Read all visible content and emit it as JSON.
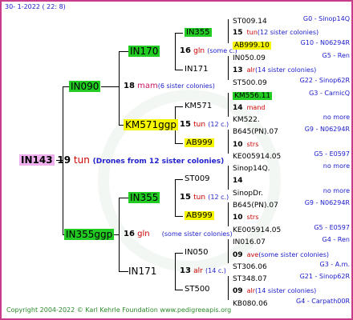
{
  "header": {
    "date": "30-   1-2022  ( 22:   8)"
  },
  "footer": {
    "copyright": "Copyright 2004-2022 © Karl Kehrle Foundation    www.pedigreeapis.org"
  },
  "root": {
    "id": "IN143",
    "gen": "19",
    "breed": "tun",
    "note": "(Drones from 12 sister colonies)"
  },
  "s": {
    "id": "IN090",
    "gen": "18",
    "breed": "mam",
    "note": "(6 sister colonies)"
  },
  "d": {
    "id": "IN355ggp",
    "gen": "16",
    "breed": "gln",
    "note": "(some sister colonies)"
  },
  "ss": {
    "id": "IN170",
    "gen": "16",
    "breed": "gln",
    "note": "(some c.)"
  },
  "sd": {
    "id": "KM571ggp",
    "gen": "15",
    "breed": "tun",
    "note": "(12 c.)"
  },
  "ds": {
    "id": "IN355",
    "gen": "15",
    "breed": "tun",
    "note": "(12 c.)"
  },
  "dd": {
    "id": "IN171",
    "gen": "13",
    "breed": "alr",
    "note": "(14 c.)"
  },
  "g4": [
    {
      "id": "IN355"
    },
    {
      "id": "IN171"
    },
    {
      "id": "KM571"
    },
    {
      "id": "AB999"
    },
    {
      "id": "ST009"
    },
    {
      "id": "AB999"
    },
    {
      "id": "IN050"
    },
    {
      "id": "ST500"
    }
  ],
  "g5": [
    {
      "id": "ST009.14",
      "gen": "",
      "breed": "",
      "note": "",
      "right": "G0 - Sinop14Q"
    },
    {
      "id": "",
      "gen": "15",
      "breed": "tun",
      "note": "(12 sister colonies)",
      "right": ""
    },
    {
      "id": "AB999.10",
      "gen": "",
      "breed": "",
      "note": "",
      "right": "G10 - N06294R"
    },
    {
      "id": "IN050.09",
      "gen": "",
      "breed": "",
      "note": "",
      "right": "G5 - Ren"
    },
    {
      "id": "",
      "gen": "13",
      "breed": "alr",
      "note": "(14 sister colonies)",
      "right": ""
    },
    {
      "id": "ST500.09",
      "gen": "",
      "breed": "",
      "note": "",
      "right": "G22 - Sinop62R"
    },
    {
      "id": "KM556.11",
      "gen": "",
      "breed": "",
      "note": "",
      "right": "G3 - CarnicQ"
    },
    {
      "id": "",
      "gen": "14",
      "breed": "mand",
      "note": "",
      "right": ""
    },
    {
      "id": "KM522.",
      "gen": "",
      "breed": "",
      "note": "",
      "right": "no more"
    },
    {
      "id": "B645(PN).07",
      "gen": "",
      "breed": "",
      "note": "",
      "right": "G9 - N06294R"
    },
    {
      "id": "",
      "gen": "10",
      "breed": "strs",
      "note": "",
      "right": ""
    },
    {
      "id": "KE005914.05",
      "gen": "",
      "breed": "",
      "note": "",
      "right": "G5 - E0597"
    },
    {
      "id": "Sinop14Q.",
      "gen": "",
      "breed": "",
      "note": "",
      "right": "no more"
    },
    {
      "id": "",
      "gen": "14",
      "breed": "",
      "note": "",
      "right": ""
    },
    {
      "id": "SinopDr.",
      "gen": "",
      "breed": "",
      "note": "",
      "right": "no more"
    },
    {
      "id": "B645(PN).07",
      "gen": "",
      "breed": "",
      "note": "",
      "right": "G9 - N06294R"
    },
    {
      "id": "",
      "gen": "10",
      "breed": "strs",
      "note": "",
      "right": ""
    },
    {
      "id": "KE005914.05",
      "gen": "",
      "breed": "",
      "note": "",
      "right": "G5 - E0597"
    },
    {
      "id": "IN016.07",
      "gen": "",
      "breed": "",
      "note": "",
      "right": "G4 - Ren"
    },
    {
      "id": "",
      "gen": "09",
      "breed": "ave",
      "note": "(some sister colonies)",
      "right": ""
    },
    {
      "id": "ST306.06",
      "gen": "",
      "breed": "",
      "note": "",
      "right": "G3 - A.m."
    },
    {
      "id": "ST348.07",
      "gen": "",
      "breed": "",
      "note": "",
      "right": "G21 - Sinop62R"
    },
    {
      "id": "",
      "gen": "09",
      "breed": "alr",
      "note": "(14 sister colonies)",
      "right": ""
    },
    {
      "id": "KB080.06",
      "gen": "",
      "breed": "",
      "note": "",
      "right": "G4 - Carpath00R"
    }
  ]
}
